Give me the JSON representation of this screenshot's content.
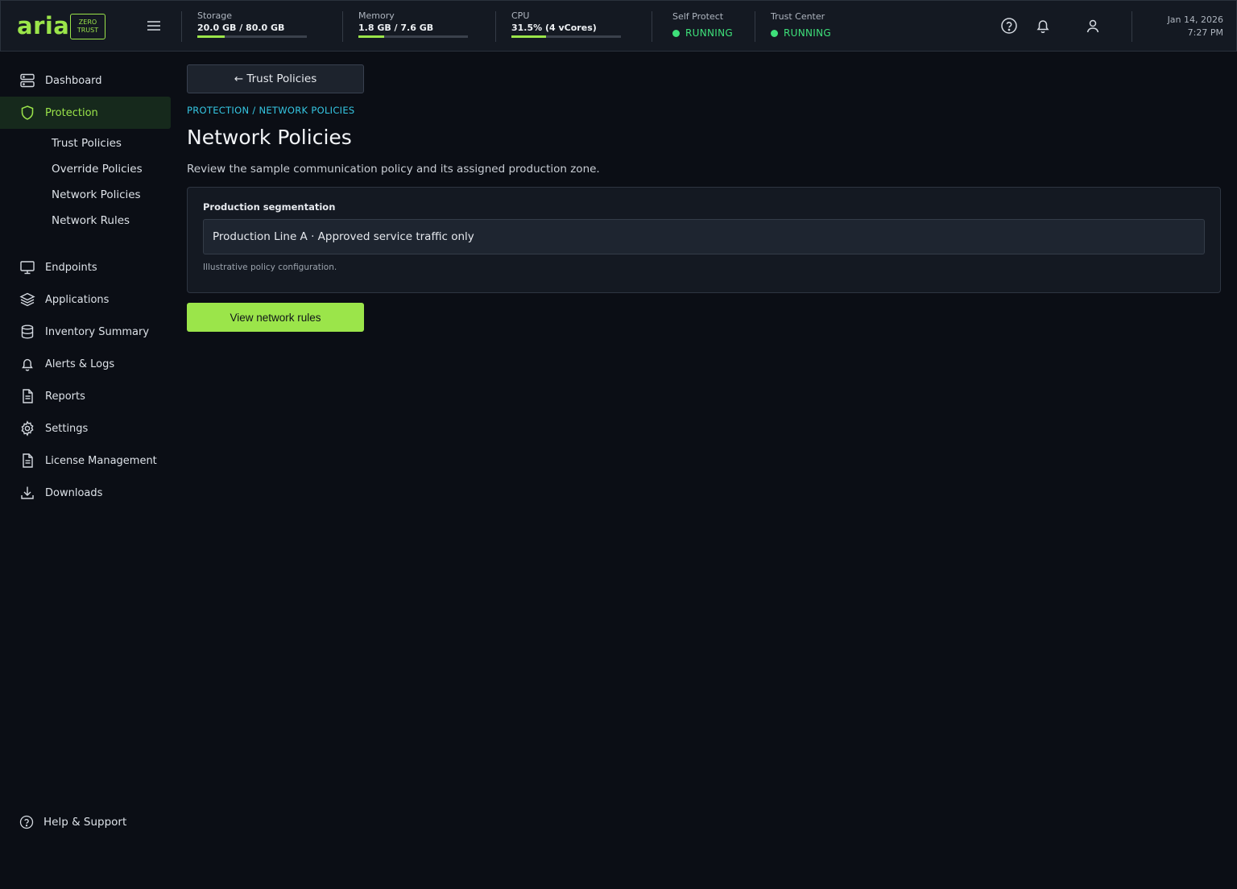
{
  "brand": {
    "logo": "aria",
    "badge_line1": "ZERO",
    "badge_line2": "TRUST",
    "accent": "#9be54a"
  },
  "topbar": {
    "metrics": [
      {
        "label": "Storage",
        "value": "20.0 GB / 80.0 GB",
        "fraction": 0.25
      },
      {
        "label": "Memory",
        "value": "1.8 GB / 7.6 GB",
        "fraction": 0.237
      },
      {
        "label": "CPU",
        "value": "31.5% (4 vCores)",
        "fraction": 0.315
      }
    ],
    "services": [
      {
        "label": "Self Protect",
        "status": "RUNNING"
      },
      {
        "label": "Trust Center",
        "status": "RUNNING"
      }
    ],
    "date": "Jan 14, 2026",
    "time": "7:27 PM"
  },
  "sidebar": {
    "items": [
      {
        "label": "Dashboard",
        "icon": "server-icon"
      },
      {
        "label": "Protection",
        "icon": "shield-icon",
        "active": true
      },
      {
        "label": "Endpoints",
        "icon": "monitor-icon"
      },
      {
        "label": "Applications",
        "icon": "layers-icon"
      },
      {
        "label": "Inventory Summary",
        "icon": "database-icon"
      },
      {
        "label": "Alerts & Logs",
        "icon": "bell-icon"
      },
      {
        "label": "Reports",
        "icon": "document-icon"
      },
      {
        "label": "Settings",
        "icon": "gear-icon"
      },
      {
        "label": "License Management",
        "icon": "document-icon"
      },
      {
        "label": "Downloads",
        "icon": "download-icon"
      }
    ],
    "sub_items": [
      {
        "label": "Trust Policies"
      },
      {
        "label": "Override Policies"
      },
      {
        "label": "Network Policies"
      },
      {
        "label": "Network Rules"
      }
    ],
    "help": "Help & Support"
  },
  "main": {
    "back_label": "← Trust Policies",
    "breadcrumb": "PROTECTION / NETWORK POLICIES",
    "title": "Network Policies",
    "description": "Review the sample communication policy and its assigned production zone.",
    "panel": {
      "label": "Production segmentation",
      "value": "Production Line A · Approved service traffic only",
      "note": "Illustrative policy configuration."
    },
    "primary_label": "View network rules"
  }
}
